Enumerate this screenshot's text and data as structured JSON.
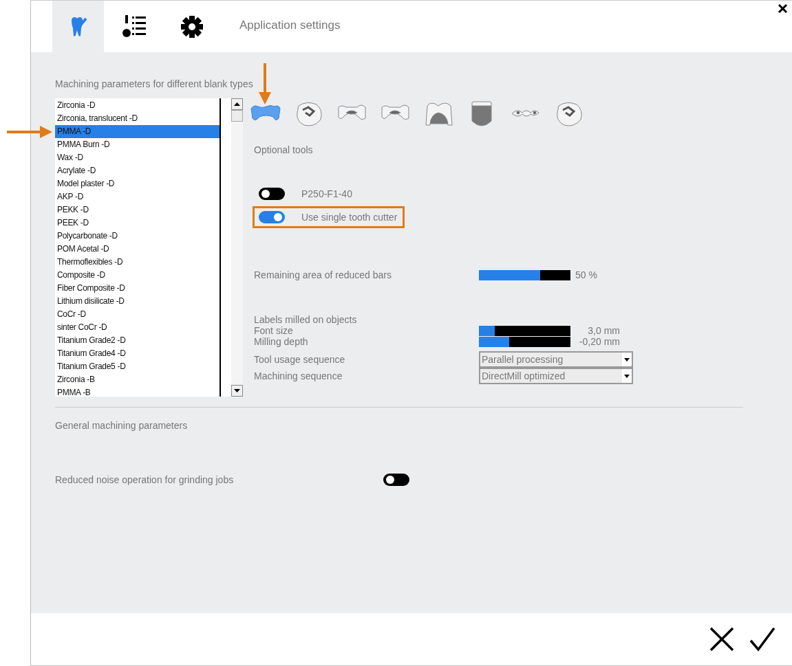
{
  "window": {
    "title": "Application settings"
  },
  "tabs": [
    {
      "kind": "tooth",
      "selected": true
    },
    {
      "kind": "tool-list",
      "selected": false
    },
    {
      "kind": "gear",
      "selected": false
    }
  ],
  "blank_types": {
    "title": "Machining parameters for different blank types",
    "materials": [
      {
        "label": "Zirconia -D",
        "selected": false
      },
      {
        "label": "Zirconia, translucent -D",
        "selected": false
      },
      {
        "label": "PMMA -D",
        "selected": true
      },
      {
        "label": "PMMA Burn -D",
        "selected": false
      },
      {
        "label": "Wax -D",
        "selected": false
      },
      {
        "label": "Acrylate -D",
        "selected": false
      },
      {
        "label": "Model plaster -D",
        "selected": false
      },
      {
        "label": "AKP -D",
        "selected": false
      },
      {
        "label": "PEKK -D",
        "selected": false
      },
      {
        "label": "PEEK -D",
        "selected": false
      },
      {
        "label": "Polycarbonate -D",
        "selected": false
      },
      {
        "label": "POM Acetal -D",
        "selected": false
      },
      {
        "label": "Thermoflexibles -D",
        "selected": false
      },
      {
        "label": "Composite -D",
        "selected": false
      },
      {
        "label": "Fiber Composite -D",
        "selected": false
      },
      {
        "label": "Lithium disilicate -D",
        "selected": false
      },
      {
        "label": "CoCr -D",
        "selected": false
      },
      {
        "label": "sinter CoCr -D",
        "selected": false
      },
      {
        "label": "Titanium Grade2 -D",
        "selected": false
      },
      {
        "label": "Titanium Grade4 -D",
        "selected": false
      },
      {
        "label": "Titanium Grade5 -D",
        "selected": false
      },
      {
        "label": "Zirconia -B",
        "selected": false
      },
      {
        "label": "PMMA -B",
        "selected": false
      }
    ],
    "restorations": [
      {
        "kind": "bridge",
        "selected": true
      },
      {
        "kind": "crown",
        "selected": false
      },
      {
        "kind": "inlay-bridge",
        "selected": false
      },
      {
        "kind": "inlay-bridge",
        "selected": false
      },
      {
        "kind": "coping",
        "selected": false
      },
      {
        "kind": "veneer",
        "selected": false
      },
      {
        "kind": "bar",
        "selected": false
      },
      {
        "kind": "crown",
        "selected": false
      }
    ],
    "optional_tools_title": "Optional tools",
    "tools": [
      {
        "label": "P250-F1-40",
        "on": false,
        "highlighted": false
      },
      {
        "label": "Use single tooth cutter",
        "on": true,
        "highlighted": true
      }
    ],
    "remaining_area": {
      "label": "Remaining area of reduced bars",
      "level": 0.67,
      "reading": "50 %"
    },
    "labels_title": "Labels milled on objects",
    "label_sliders": [
      {
        "label": "Font size",
        "level": 0.17,
        "reading": "3,0 mm"
      },
      {
        "label": "Milling depth",
        "level": 0.33,
        "reading": "-0,20 mm"
      }
    ],
    "dropdowns": [
      {
        "label": "Tool usage sequence",
        "value": "Parallel processing"
      },
      {
        "label": "Machining sequence",
        "value": "DirectMill optimized"
      }
    ]
  },
  "general": {
    "title": "General machining parameters",
    "settings": [
      {
        "label": "Reduced noise operation for grinding jobs",
        "on": false
      }
    ]
  }
}
